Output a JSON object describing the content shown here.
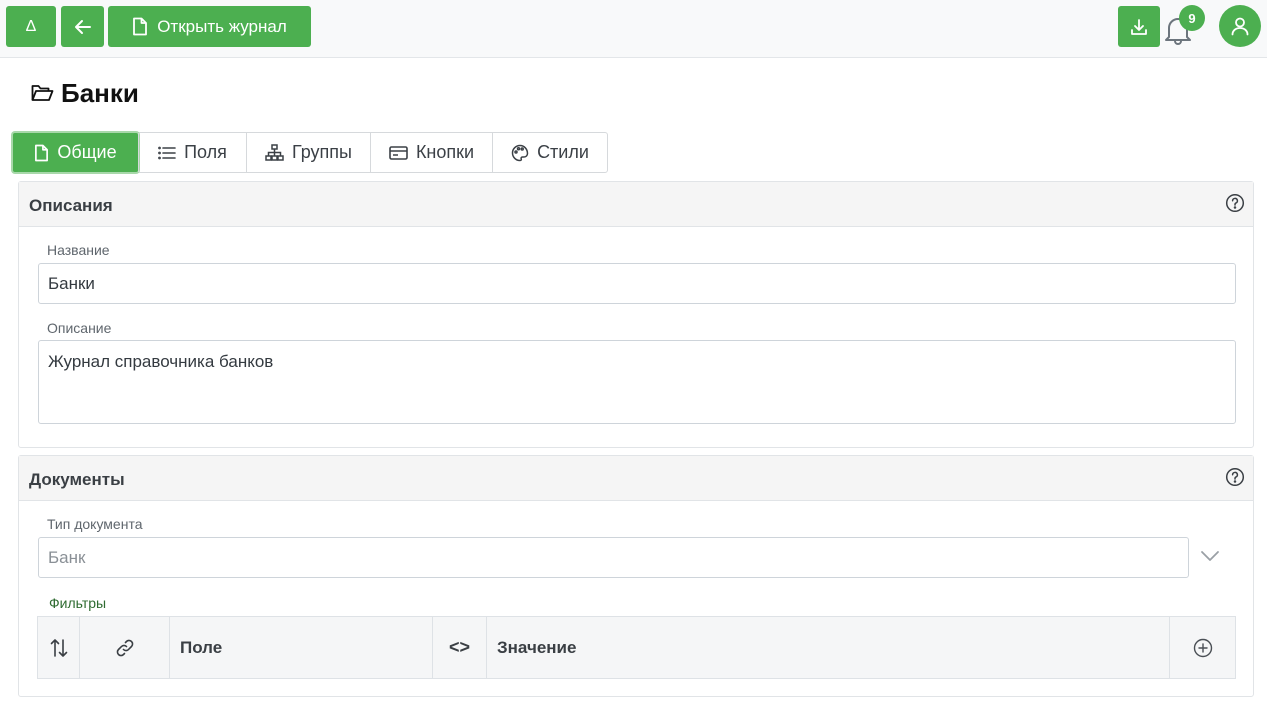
{
  "toolbar": {
    "delta_label": "Δ",
    "open_journal_label": "Открыть журнал",
    "notification_count": "9"
  },
  "page": {
    "title": "Банки"
  },
  "tabs": [
    {
      "label": "Общие",
      "icon": "file-icon",
      "active": true
    },
    {
      "label": "Поля",
      "icon": "list-icon"
    },
    {
      "label": "Группы",
      "icon": "sitemap-icon"
    },
    {
      "label": "Кнопки",
      "icon": "button-icon"
    },
    {
      "label": "Стили",
      "icon": "palette-icon"
    }
  ],
  "descriptions": {
    "title": "Описания",
    "name_label": "Название",
    "name_value": "Банки",
    "description_label": "Описание",
    "description_value": "Журнал справочника банков"
  },
  "documents": {
    "title": "Документы",
    "doc_type_label": "Тип документа",
    "doc_type_value": "Банк",
    "filters_label": "Фильтры",
    "columns": {
      "field": "Поле",
      "operator": "<>",
      "value": "Значение"
    }
  },
  "colors": {
    "accent": "#4caf50"
  }
}
